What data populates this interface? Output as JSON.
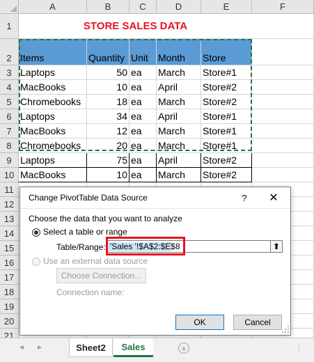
{
  "columns": [
    "A",
    "B",
    "C",
    "D",
    "E",
    "F"
  ],
  "rows": [
    "1",
    "2",
    "3",
    "4",
    "5",
    "6",
    "7",
    "8",
    "9",
    "10",
    "11",
    "12",
    "13",
    "14",
    "15",
    "16",
    "17",
    "18",
    "19",
    "20",
    "21"
  ],
  "title": "STORE SALES DATA",
  "header": {
    "items": "Items",
    "quantity": "Quantity",
    "unit": "Unit",
    "month": "Month",
    "store": "Store"
  },
  "data": [
    [
      "Laptops",
      "50",
      "ea",
      "March",
      "Store#1"
    ],
    [
      "MacBooks",
      "10",
      "ea",
      "April",
      "Store#2"
    ],
    [
      "Chromebooks",
      "18",
      "ea",
      "March",
      "Store#2"
    ],
    [
      "Laptops",
      "34",
      "ea",
      "April",
      "Store#1"
    ],
    [
      "MacBooks",
      "12",
      "ea",
      "March",
      "Store#1"
    ],
    [
      "Chromebooks",
      "20",
      "ea",
      "March",
      "Store#1"
    ],
    [
      "Laptops",
      "75",
      "ea",
      "April",
      "Store#2"
    ],
    [
      "MacBooks",
      "10",
      "ea",
      "March",
      "Store#2"
    ]
  ],
  "colors": {
    "header_fill": "#5b9bd5",
    "title": "#e81123",
    "marquee": "#217346",
    "highlight_box": "#e81123"
  },
  "dialog": {
    "title": "Change PivotTable Data Source",
    "help": "?",
    "close": "✕",
    "instruction": "Choose the data that you want to analyze",
    "option_table": "Select a table or range",
    "range_label": "Table/Range:",
    "range_value": "'Sales '!$A$2:$E$8",
    "collapse_icon": "⬆",
    "option_external": "Use an external data source",
    "choose_connection": "Choose Connection...",
    "connection_name": "Connection name:",
    "ok": "OK",
    "cancel": "Cancel"
  },
  "tabs": {
    "sheet2": "Sheet2",
    "sales": "Sales",
    "add": "+",
    "prev": "◄",
    "next": "►",
    "more": "⋮"
  }
}
